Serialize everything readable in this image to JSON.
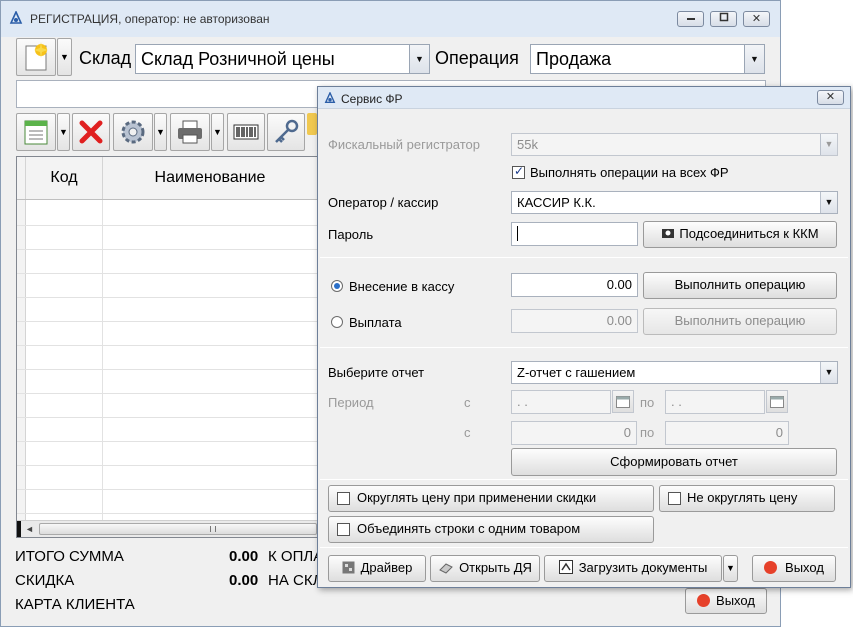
{
  "main_window": {
    "title": "РЕГИСТРАЦИЯ, оператор: не авторизован",
    "min_icon": "minimize-icon",
    "max_icon": "maximize-icon",
    "close_glyph": "✕",
    "warehouse_label": "Склад",
    "warehouse_value": "Склад Розничной цены",
    "operation_label": "Операция",
    "operation_value": "Продажа",
    "grid": {
      "columns": [
        "Код",
        "Наименование"
      ]
    },
    "totals": {
      "total_label": "ИТОГО СУММА",
      "total_value": "0.00",
      "to_pay_label": "К ОПЛА",
      "discount_label": "СКИДКА",
      "discount_value": "0.00",
      "discount_suffix": "НА СКЛ",
      "card_label": "КАРТА КЛИЕНТА"
    },
    "exit_button": "Выход"
  },
  "dialog": {
    "title": "Сервис ФР",
    "fiscal_label": "Фискальный регистратор",
    "fiscal_value": "55k",
    "all_fr_label": "Выполнять операции на всех ФР",
    "all_fr_checked": true,
    "operator_label": "Оператор / кассир",
    "operator_value": "КАССИР К.К.",
    "password_label": "Пароль",
    "password_value": "",
    "connect_button": "Подсоединиться к ККМ",
    "deposit_label": "Внесение в кассу",
    "deposit_value": "0.00",
    "deposit_exec": "Выполнить операцию",
    "payout_label": "Выплата",
    "payout_value": "0.00",
    "payout_exec": "Выполнить операцию",
    "report_label": "Выберите отчет",
    "report_value": "Z-отчет с гашением",
    "period_label": "Период",
    "from_label": "с",
    "to_label": "по",
    "date_from": " .  .",
    "date_to": " .  .",
    "num_from_label": "с",
    "num_to_label": "по",
    "num_from": "0",
    "num_to": "0",
    "form_report_button": "Сформировать отчет",
    "round_price_label": "Округлять цену при применении скидки",
    "no_round_label": "Не округлять цену",
    "merge_rows_label": "Объединять строки с одним товаром",
    "driver_button": "Драйвер",
    "open_drawer_button": "Открыть ДЯ",
    "load_docs_button": "Загрузить документы",
    "exit_button": "Выход",
    "close_glyph": "✕"
  }
}
